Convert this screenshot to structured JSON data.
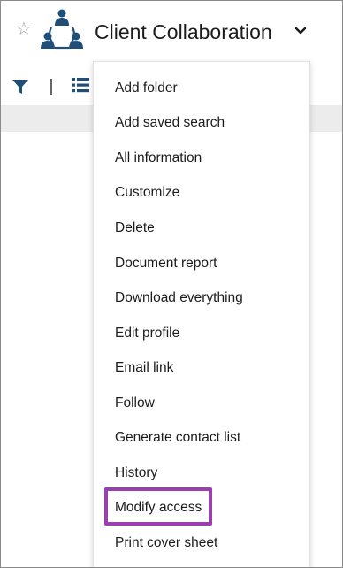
{
  "header": {
    "title": "Client Collaboration",
    "icons": {
      "favorite": "star-icon",
      "workspace": "group-people-icon",
      "expand": "chevron-down-icon"
    }
  },
  "toolbar": {
    "icons": {
      "filter": "filter-icon",
      "view": "list-view-icon"
    }
  },
  "menu": {
    "items": [
      {
        "label": "Add folder"
      },
      {
        "label": "Add saved search"
      },
      {
        "label": "All information"
      },
      {
        "label": "Customize"
      },
      {
        "label": "Delete"
      },
      {
        "label": "Document report"
      },
      {
        "label": "Download everything"
      },
      {
        "label": "Edit profile"
      },
      {
        "label": "Email link"
      },
      {
        "label": "Follow"
      },
      {
        "label": "Generate contact list"
      },
      {
        "label": "History"
      },
      {
        "label": "Modify access"
      },
      {
        "label": "Print cover sheet"
      }
    ],
    "highlighted_item": "Modify access",
    "highlight_color": "#9b3fb0"
  },
  "colors": {
    "icon_blue": "#1f4e79",
    "star_grey": "#9a9a9a"
  }
}
